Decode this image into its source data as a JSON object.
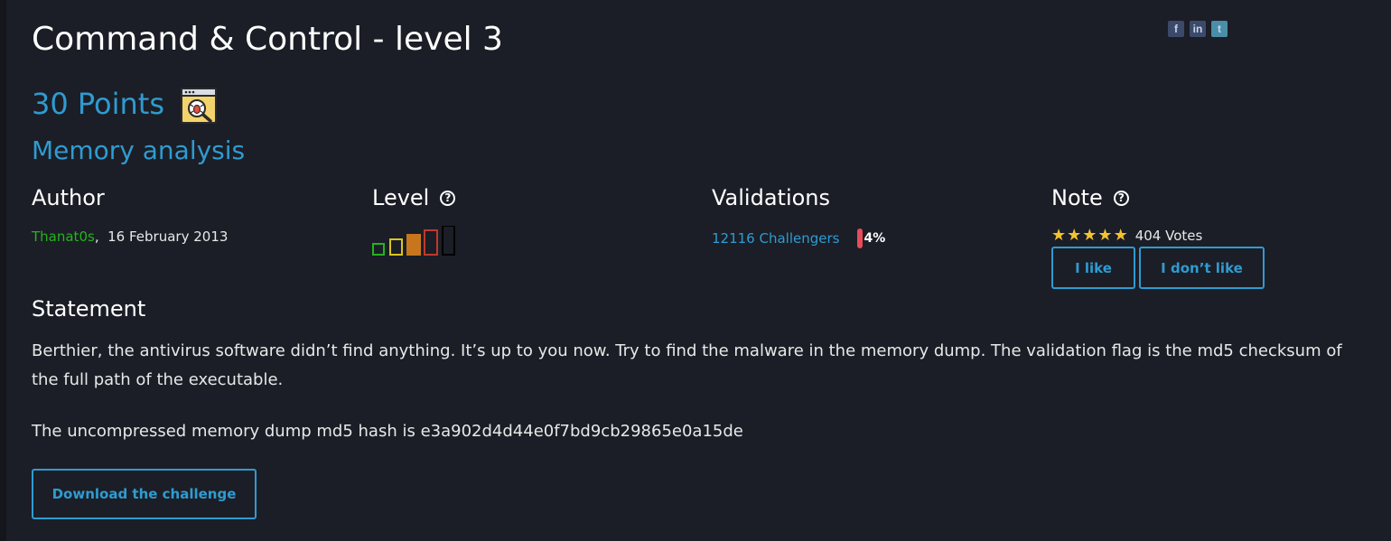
{
  "challenge": {
    "title": "Command & Control - level 3",
    "points": "30 Points",
    "category": "Memory analysis",
    "category_icon": "bug-search-icon"
  },
  "social": {
    "facebook": "f",
    "linkedin": "in",
    "twitter": "t"
  },
  "author": {
    "heading": "Author",
    "name": "Thanat0s",
    "separator": ",",
    "date": "16 February 2013"
  },
  "level": {
    "heading": "Level",
    "help_icon": "question-circle-icon",
    "bars": [
      {
        "color": "#25b31d",
        "filled": false
      },
      {
        "color": "#d9c520",
        "filled": false
      },
      {
        "color": "#c8761e",
        "filled": true
      },
      {
        "color": "#c0392b",
        "filled": false
      },
      {
        "color": "#000000",
        "filled": false
      }
    ],
    "current_level": 3,
    "max_level": 5
  },
  "validations": {
    "heading": "Validations",
    "challengers": "12116 Challengers",
    "percent": "4%",
    "bar_color": "#e74c5a"
  },
  "note": {
    "heading": "Note",
    "help_icon": "question-circle-icon",
    "stars": 5,
    "star_color": "#f2c230",
    "votes": "404 Votes",
    "like_label": "I like",
    "dislike_label": "I don’t like"
  },
  "statement": {
    "heading": "Statement",
    "text": "Berthier, the antivirus software didn’t find anything. It’s up to you now. Try to find the malware in the memory dump. The validation flag is the md5 checksum of the full path of the executable.",
    "hash_text": "The uncompressed memory dump md5 hash is e3a902d4d44e0f7bd9cb29865e0a15de",
    "download_label": "Download the challenge"
  },
  "colors": {
    "background": "#1b1e26",
    "accent": "#2f9bd1",
    "author_green": "#25b31d"
  }
}
